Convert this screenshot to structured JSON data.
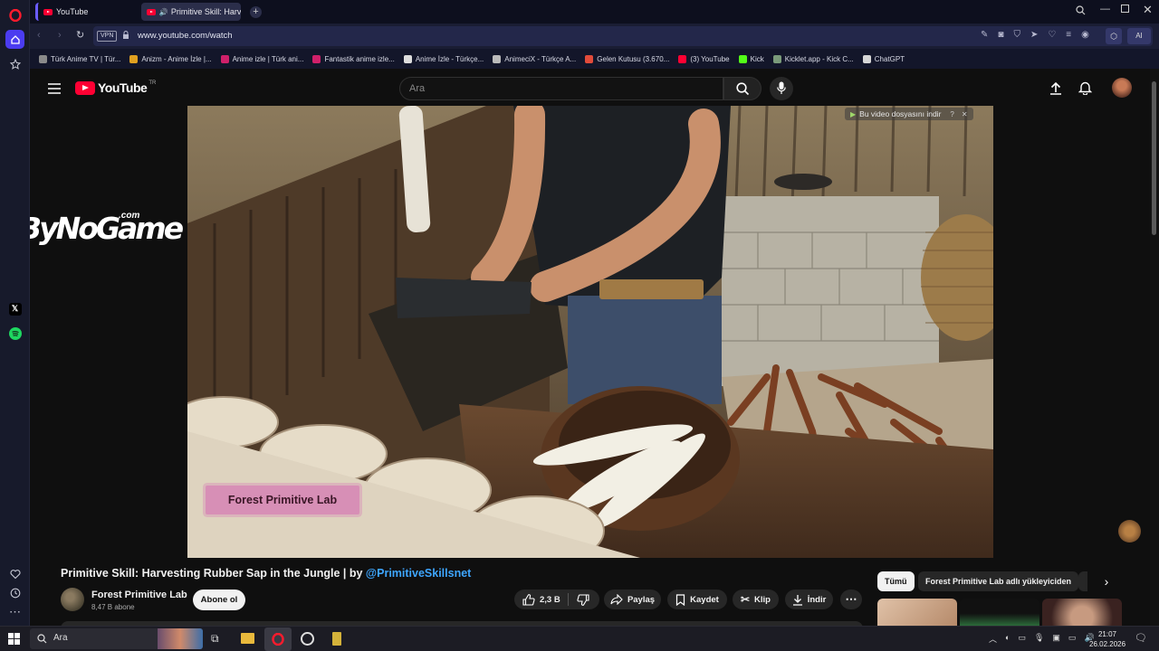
{
  "browser": {
    "tabs": [
      {
        "label": "YouTube"
      },
      {
        "label": "Primitive Skill: Harvest"
      }
    ],
    "url": "www.youtube.com/watch",
    "vpn_label": "VPN",
    "ai_label": "AI",
    "bookmarks": [
      {
        "label": "Türk Anime TV | Tür...",
        "color": "#8a8a8a"
      },
      {
        "label": "Anizm - Anime İzle |...",
        "color": "#e0a020"
      },
      {
        "label": "Anime izle | Türk ani...",
        "color": "#d0206a"
      },
      {
        "label": "Fantastik anime izle...",
        "color": "#d0206a"
      },
      {
        "label": "Anime İzle - Türkçe...",
        "color": "#dddddd"
      },
      {
        "label": "AnimeciX - Türkçe A...",
        "color": "#bbbbbb"
      },
      {
        "label": "Gelen Kutusu (3.670...",
        "color": "#e24b3a"
      },
      {
        "label": "(3) YouTube",
        "color": "#ff0033"
      },
      {
        "label": "Kick",
        "color": "#53fc18"
      },
      {
        "label": "Kicklet.app - Kick C...",
        "color": "#7a9a7a"
      },
      {
        "label": "ChatGPT",
        "color": "#d6d6d6"
      }
    ]
  },
  "youtube": {
    "logo_text": "YouTube",
    "country_code": "TR",
    "search_placeholder": "Ara",
    "video": {
      "download_overlay": "Bu video dosyasını indir",
      "download_overlay_help": "?",
      "watermark": "Forest Primitive Lab"
    },
    "side_watermark": "ByNoGame",
    "side_watermark_suffix": ".com",
    "title_prefix": "Primitive Skill: Harvesting Rubber Sap in the Jungle | by ",
    "title_handle": "@PrimitiveSkillsnet",
    "channel_name": "Forest Primitive Lab",
    "subscribers": "8,47 B abone",
    "subscribe_label": "Abone ol",
    "actions": {
      "likes": "2,3 B",
      "share": "Paylaş",
      "save": "Kaydet",
      "clip": "Klip",
      "download": "İndir"
    },
    "chips": [
      {
        "label": "Tümü",
        "active": true
      },
      {
        "label": "Forest Primitive Lab adlı yükleyiciden",
        "active": false
      }
    ]
  },
  "taskbar": {
    "search_placeholder": "Ara",
    "time": "21:07",
    "date": "26.02.2026"
  },
  "colors": {
    "accent_red": "#ff0033",
    "link_blue": "#3ea6ff",
    "opera_sidebar": "#171a2b"
  }
}
